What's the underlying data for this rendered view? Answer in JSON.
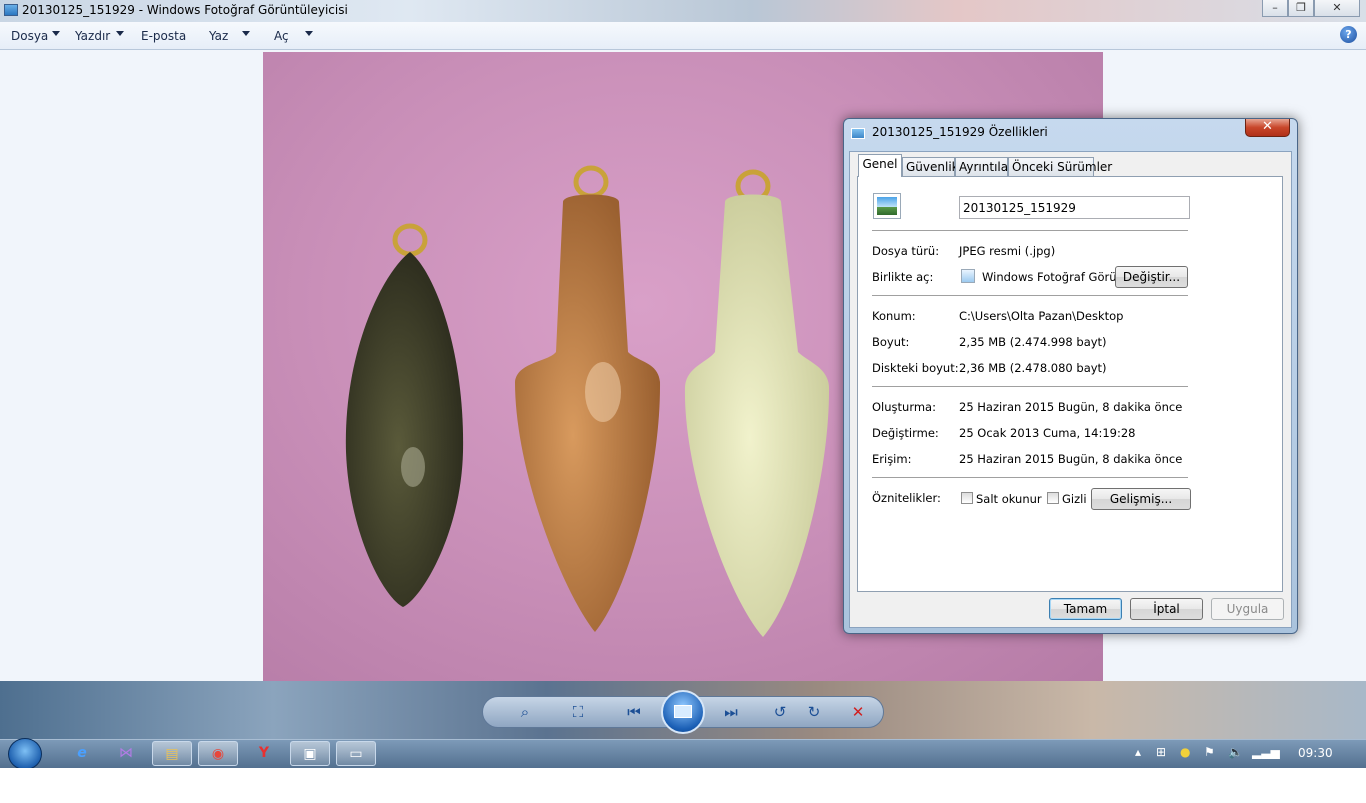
{
  "window": {
    "title": "20130125_151929 - Windows Fotoğraf Görüntüleyicisi",
    "caption_buttons": [
      "–",
      "❐",
      "✕"
    ]
  },
  "menu": {
    "items": [
      {
        "label": "Dosya",
        "has_arrow": true
      },
      {
        "label": "Yazdır",
        "has_arrow": true
      },
      {
        "label": "E-posta",
        "has_arrow": false
      },
      {
        "label": "Yaz",
        "has_arrow": true
      },
      {
        "label": "Aç",
        "has_arrow": true
      }
    ],
    "help": "?"
  },
  "dialog": {
    "title": "20130125_151929 Özellikleri",
    "close": "✕",
    "tabs": [
      "Genel",
      "Güvenlik",
      "Ayrıntılar",
      "Önceki Sürümler"
    ],
    "active_tab": "Genel",
    "file_name": "20130125_151929",
    "rows": {
      "type_label": "Dosya türü:",
      "type_value": "JPEG resmi (.jpg)",
      "opens_label": "Birlikte aç:",
      "opens_value": "Windows Fotoğraf Görüntü",
      "change_button": "Değiştir...",
      "location_label": "Konum:",
      "location_value": "C:\\Users\\Olta Pazan\\Desktop",
      "size_label": "Boyut:",
      "size_value": "2,35 MB (2.474.998 bayt)",
      "disk_label": "Diskteki boyut:",
      "disk_value": "2,36 MB (2.478.080 bayt)",
      "created_label": "Oluşturma:",
      "created_value": "25 Haziran 2015 Bugün, 8 dakika önce",
      "modified_label": "Değiştirme:",
      "modified_value": "25 Ocak 2013 Cuma, 14:19:28",
      "accessed_label": "Erişim:",
      "accessed_value": "25 Haziran 2015 Bugün, 8 dakika önce",
      "attributes_label": "Öznitelikler:",
      "readonly_label": "Salt okunur",
      "hidden_label": "Gizli",
      "advanced_button": "Gelişmiş..."
    },
    "buttons": {
      "ok": "Tamam",
      "cancel": "İptal",
      "apply": "Uygula"
    }
  },
  "taskbar": {
    "clock": "09:30"
  },
  "colors": {
    "accent": "#1d5fae",
    "dialog_frame": "#aac3dd",
    "photo_background": "#c98fb8"
  }
}
